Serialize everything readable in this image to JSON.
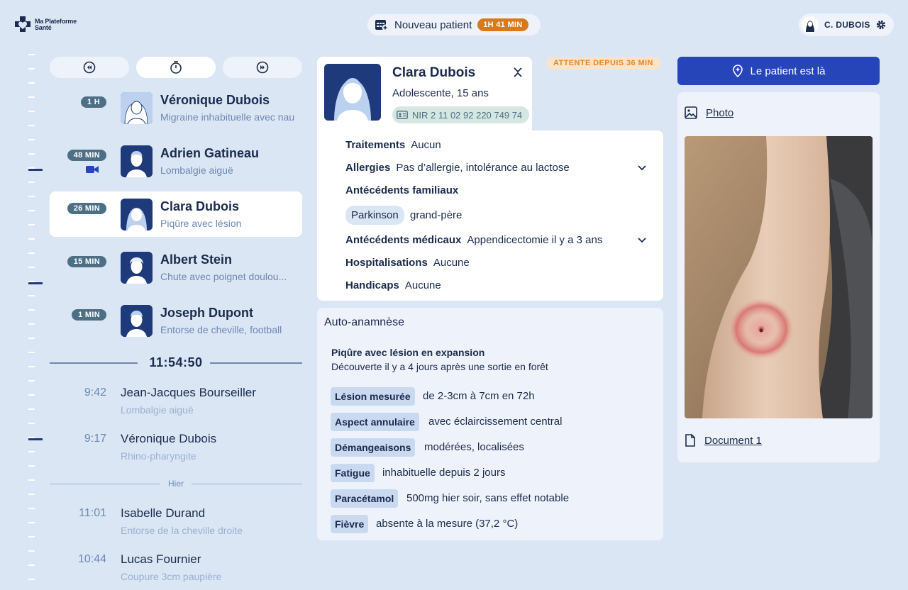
{
  "brand": {
    "line1": "Ma Plateforme",
    "line2": "Santé"
  },
  "topbar": {
    "new_patient_label": "Nouveau patient",
    "new_patient_wait": "1H 41 MIN"
  },
  "user": {
    "name": "C. DUBOIS"
  },
  "queue": [
    {
      "wait": "1 H",
      "name": "Véronique Dubois",
      "reason": "Migraine inhabituelle avec nau"
    },
    {
      "wait": "48 MIN",
      "name": "Adrien Gatineau",
      "reason": "Lombalgie aiguë",
      "video": true
    },
    {
      "wait": "26 MIN",
      "name": "Clara Dubois",
      "reason": "Piqûre avec lésion",
      "selected": true
    },
    {
      "wait": "15 MIN",
      "name": "Albert Stein",
      "reason": "Chute avec poignet doulou..."
    },
    {
      "wait": "1 MIN",
      "name": "Joseph Dupont",
      "reason": "Entorse de cheville, football"
    }
  ],
  "clock": "11:54:50",
  "history_today": [
    {
      "time": "9:42",
      "name": "Jean-Jacques Bourseiller",
      "reason": "Lombalgie aiguë"
    },
    {
      "time": "9:17",
      "name": "Véronique Dubois",
      "reason": "Rhino-pharyngite"
    }
  ],
  "history_label": "Hier",
  "history_yesterday": [
    {
      "time": "11:01",
      "name": "Isabelle Durand",
      "reason": "Entorse de la cheville droite"
    },
    {
      "time": "10:44",
      "name": "Lucas Fournier",
      "reason": "Coupure 3cm paupière"
    }
  ],
  "patient": {
    "name": "Clara Dubois",
    "age": "Adolescente, 15 ans",
    "nir": "NIR 2 11 02 92 220 749 74",
    "waiting": "ATTENTE DEPUIS 36 MIN",
    "traitements_label": "Traitements",
    "traitements": "Aucun",
    "allergies_label": "Allergies",
    "allergies": "Pas d’allergie, intolérance au lactose",
    "famille_label": "Antécédents familiaux",
    "famille_chip": "Parkinson",
    "famille_rel": "grand-père",
    "medicaux_label": "Antécédents médicaux",
    "medicaux": "Appendicectomie il y a 3 ans",
    "hosp_label": "Hospitalisations",
    "hosp": "Aucune",
    "handicap_label": "Handicaps",
    "handicap": "Aucune"
  },
  "anamnese": {
    "title": "Auto-anamnèse",
    "heading": "Piqûre avec lésion en expansion",
    "subheading": "Découverte il y a 4 jours après une sortie en forêt",
    "symptoms": [
      {
        "label": "Lésion mesurée",
        "value": "de 2-3cm à 7cm en 72h"
      },
      {
        "label": "Aspect annulaire",
        "value": "avec éclaircissement central"
      },
      {
        "label": "Démangeaisons",
        "value": "modérées, localisées"
      },
      {
        "label": "Fatigue",
        "value": "inhabituelle depuis 2 jours"
      },
      {
        "label": "Paracétamol",
        "value": "500mg hier soir, sans effet notable"
      },
      {
        "label": "Fièvre",
        "value": "absente à la mesure (37,2 °C)"
      }
    ]
  },
  "right": {
    "arrived_label": "Le patient est là",
    "photo_label": "Photo",
    "document_label": "Document 1"
  },
  "colors": {
    "navy": "#1a2b4d",
    "accent_blue": "#2545b8",
    "orange": "#d87a1c",
    "bg": "#dbe6f5"
  }
}
